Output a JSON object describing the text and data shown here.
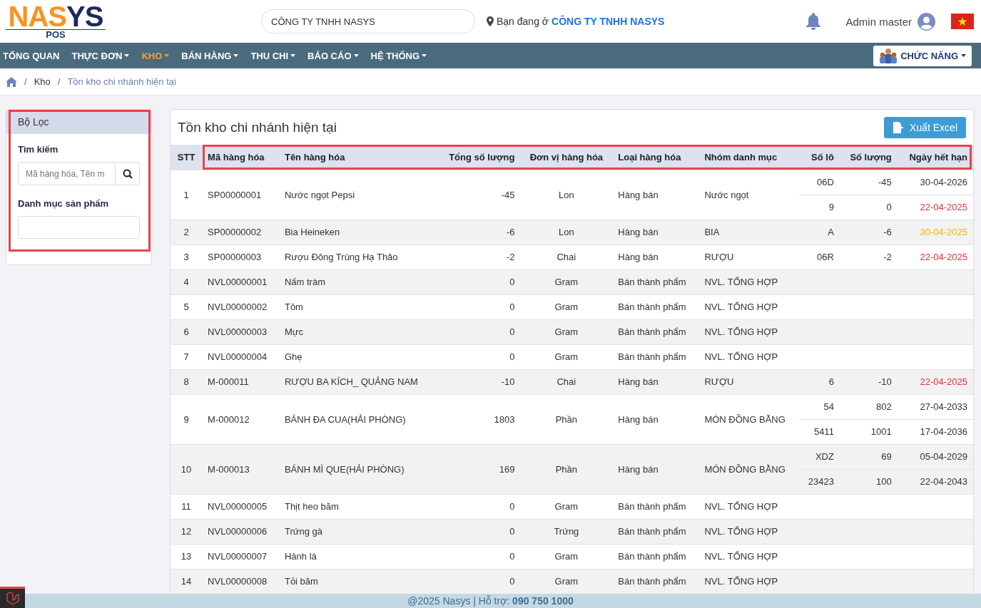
{
  "header": {
    "logo": {
      "main_a": "NA",
      "main_s": "S",
      "main_b": "YS",
      "sub": "POS"
    },
    "company_field": "CÔNG TY TNHH NASYS",
    "location_prefix": "Bạn đang ở",
    "location_company": "CÔNG TY TNHH NASYS",
    "user": "Admin master"
  },
  "nav": {
    "items": [
      {
        "label": "TỔNG QUAN",
        "dropdown": false,
        "selected": false
      },
      {
        "label": "THỰC ĐƠN",
        "dropdown": true,
        "selected": false
      },
      {
        "label": "KHO",
        "dropdown": true,
        "selected": true
      },
      {
        "label": "BÁN HÀNG",
        "dropdown": true,
        "selected": false
      },
      {
        "label": "THU CHI",
        "dropdown": true,
        "selected": false
      },
      {
        "label": "BÁO CÁO",
        "dropdown": true,
        "selected": false
      },
      {
        "label": "HỆ THỐNG",
        "dropdown": true,
        "selected": false
      }
    ],
    "function_button": "CHỨC NĂNG"
  },
  "breadcrumb": [
    {
      "separator": "/",
      "label": "Kho",
      "current": false
    },
    {
      "separator": "/",
      "label": "Tồn kho chi nhánh hiện tại",
      "current": true
    }
  ],
  "filter": {
    "title": "Bộ Lọc",
    "highlighted": true,
    "search_label": "Tìm kiếm",
    "search_placeholder": "Mã hàng hóa, Tên m",
    "category_label": "Danh mục sản phẩm"
  },
  "panel": {
    "title": "Tồn kho chi nhánh hiện tại",
    "export_button": "Xuất Excel"
  },
  "table": {
    "header_highlighted": true,
    "columns": [
      "STT",
      "Mã hàng hóa",
      "Tên hàng hóa",
      "Tổng số lượng",
      "Đơn vị hàng hóa",
      "Loại hàng hóa",
      "Nhóm danh mục",
      "Số lô",
      "Số lượng",
      "Ngày hết hạn"
    ],
    "rows": [
      {
        "stt": "1",
        "code": "SP00000001",
        "name": "Nước ngọt Pepsi",
        "total": "-45",
        "unit": "Lon",
        "type": "Hàng bán",
        "group": "Nước ngọt",
        "lots": [
          {
            "lot": "06D",
            "qty": "-45",
            "expiry": "30-04-2026",
            "color": "#333333"
          },
          {
            "lot": "9",
            "qty": "0",
            "expiry": "22-04-2025",
            "color": "#e0303a"
          }
        ]
      },
      {
        "stt": "2",
        "code": "SP00000002",
        "name": "Bia Heineken",
        "total": "-6",
        "unit": "Lon",
        "type": "Hàng bán",
        "group": "BIA",
        "lots": [
          {
            "lot": "A",
            "qty": "-6",
            "expiry": "30-04-2025",
            "color": "#f5b800"
          }
        ]
      },
      {
        "stt": "3",
        "code": "SP00000003",
        "name": "Rượu Đông Trùng Hạ Thảo",
        "total": "-2",
        "unit": "Chai",
        "type": "Hàng bán",
        "group": "RƯỢU",
        "lots": [
          {
            "lot": "06R",
            "qty": "-2",
            "expiry": "22-04-2025",
            "color": "#e0303a"
          }
        ]
      },
      {
        "stt": "4",
        "code": "NVL00000001",
        "name": "Nấm tràm",
        "total": "0",
        "unit": "Gram",
        "type": "Bán thành phẩm",
        "group": "NVL. TỔNG HỢP",
        "lots": []
      },
      {
        "stt": "5",
        "code": "NVL00000002",
        "name": "Tôm",
        "total": "0",
        "unit": "Gram",
        "type": "Bán thành phẩm",
        "group": "NVL. TỔNG HỢP",
        "lots": []
      },
      {
        "stt": "6",
        "code": "NVL00000003",
        "name": "Mực",
        "total": "0",
        "unit": "Gram",
        "type": "Bán thành phẩm",
        "group": "NVL. TỔNG HỢP",
        "lots": []
      },
      {
        "stt": "7",
        "code": "NVL00000004",
        "name": "Ghẹ",
        "total": "0",
        "unit": "Gram",
        "type": "Bán thành phẩm",
        "group": "NVL. TỔNG HỢP",
        "lots": []
      },
      {
        "stt": "8",
        "code": "M-000011",
        "name": "RƯỢU BA KÍCH_ QUẢNG NAM",
        "total": "-10",
        "unit": "Chai",
        "type": "Hàng bán",
        "group": "RƯỢU",
        "lots": [
          {
            "lot": "6",
            "qty": "-10",
            "expiry": "22-04-2025",
            "color": "#e0303a"
          }
        ]
      },
      {
        "stt": "9",
        "code": "M-000012",
        "name": "BÁNH ĐA CUA(HẢI PHÒNG)",
        "total": "1803",
        "unit": "Phần",
        "type": "Hàng bán",
        "group": "MÓN ĐỒNG BẰNG",
        "lots": [
          {
            "lot": "54",
            "qty": "802",
            "expiry": "27-04-2033",
            "color": "#333333"
          },
          {
            "lot": "5411",
            "qty": "1001",
            "expiry": "17-04-2036",
            "color": "#333333"
          }
        ]
      },
      {
        "stt": "10",
        "code": "M-000013",
        "name": "BÁNH MÌ QUE(HẢI PHÒNG)",
        "total": "169",
        "unit": "Phần",
        "type": "Hàng bán",
        "group": "MÓN ĐỒNG BẰNG",
        "lots": [
          {
            "lot": "XDZ",
            "qty": "69",
            "expiry": "05-04-2029",
            "color": "#333333"
          },
          {
            "lot": "23423",
            "qty": "100",
            "expiry": "22-04-2043",
            "color": "#333333"
          }
        ]
      },
      {
        "stt": "11",
        "code": "NVL00000005",
        "name": "Thịt heo băm",
        "total": "0",
        "unit": "Gram",
        "type": "Bán thành phẩm",
        "group": "NVL. TỔNG HỢP",
        "lots": []
      },
      {
        "stt": "12",
        "code": "NVL00000006",
        "name": "Trứng gà",
        "total": "0",
        "unit": "Trứng",
        "type": "Bán thành phẩm",
        "group": "NVL. TỔNG HỢP",
        "lots": []
      },
      {
        "stt": "13",
        "code": "NVL00000007",
        "name": "Hành lá",
        "total": "0",
        "unit": "Gram",
        "type": "Bán thành phẩm",
        "group": "NVL. TỔNG HỢP",
        "lots": []
      },
      {
        "stt": "14",
        "code": "NVL00000008",
        "name": "Tỏi băm",
        "total": "0",
        "unit": "Gram",
        "type": "Bán thành phẩm",
        "group": "NVL. TỔNG HỢP",
        "lots": []
      }
    ]
  },
  "footer": {
    "text": "@2025 Nasys | Hỗ trợ:",
    "phone": "090 750 1000"
  }
}
